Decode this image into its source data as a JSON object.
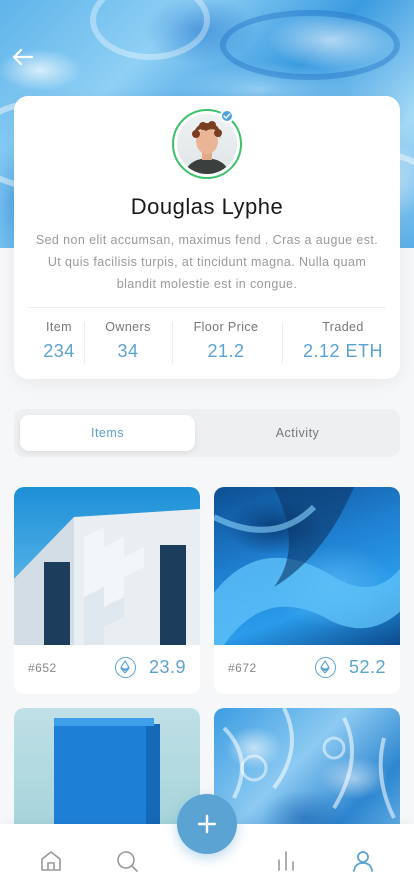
{
  "colors": {
    "accent": "#5aa3d3",
    "verified_badge": "#4aa3e0",
    "avatar_ring": "#3cc36a"
  },
  "header": {
    "back_icon": "arrow-left-icon"
  },
  "profile": {
    "name": "Douglas Lyphe",
    "verified_icon": "check-badge-icon",
    "bio": "Sed non elit accumsan, maximus fend . Cras a augue est. Ut quis facilisis turpis, at tincidunt magna. Nulla quam blandit molestie est in congue."
  },
  "stats": [
    {
      "label": "Item",
      "value": "234"
    },
    {
      "label": "Owners",
      "value": "34"
    },
    {
      "label": "Floor Price",
      "value": "21.2"
    },
    {
      "label": "Traded",
      "value": "2.12 ETH"
    }
  ],
  "tabs": [
    {
      "label": "Items",
      "active": true
    },
    {
      "label": "Activity",
      "active": false
    }
  ],
  "items": [
    {
      "id": "#652",
      "price": "23.9",
      "currency_icon": "ethereum-icon"
    },
    {
      "id": "#672",
      "price": "52.2",
      "currency_icon": "ethereum-icon"
    },
    {
      "id": "",
      "price": ""
    },
    {
      "id": "",
      "price": ""
    }
  ],
  "nav": {
    "items": [
      "home-icon",
      "search-icon",
      "chart-icon",
      "profile-icon"
    ],
    "fab_icon": "plus-icon"
  }
}
